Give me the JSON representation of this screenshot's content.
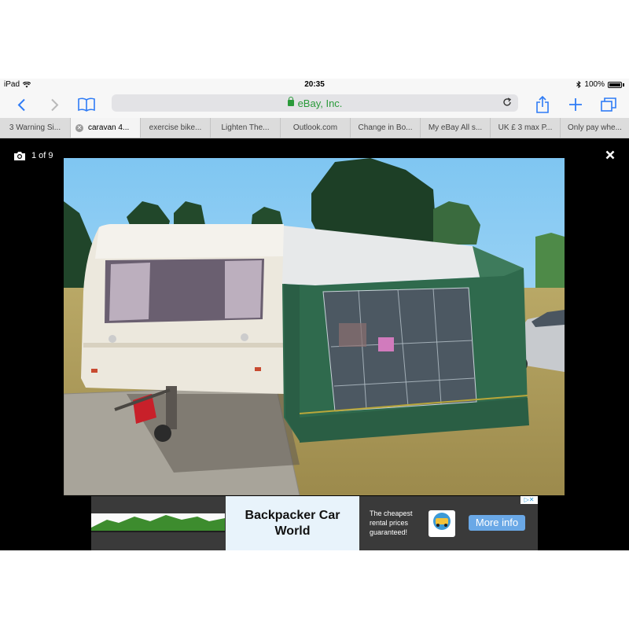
{
  "status": {
    "device": "iPad",
    "time": "20:35",
    "battery": "100%"
  },
  "browser": {
    "address": "eBay, Inc."
  },
  "tabs": [
    {
      "label": "3 Warning Si..."
    },
    {
      "label": "caravan 4..."
    },
    {
      "label": "exercise bike..."
    },
    {
      "label": "Lighten The..."
    },
    {
      "label": "Outlook.com"
    },
    {
      "label": "Change in Bo..."
    },
    {
      "label": "My eBay All s..."
    },
    {
      "label": "UK £ 3 max P..."
    },
    {
      "label": "Only pay whe..."
    }
  ],
  "viewer": {
    "counter": "1 of 9"
  },
  "ad": {
    "title": "Backpacker Car World",
    "description": "The cheapest rental prices guaranteed!",
    "logo_text": "backpacker carworld",
    "button": "More info",
    "adchoices_icon": "adchoices-icon"
  },
  "colors": {
    "accent": "#2f7cf6",
    "secure": "#2a9a3a",
    "viewer_bg": "#000000",
    "ad_button": "#6aa8e6"
  }
}
